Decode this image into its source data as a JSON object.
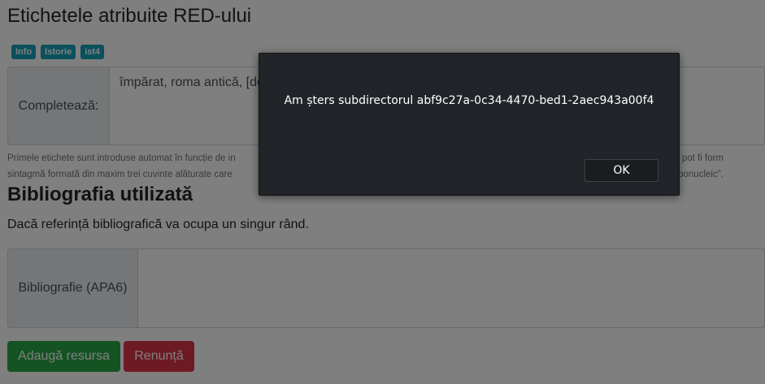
{
  "etichete": {
    "title": "Etichetele atribuite RED-ului",
    "tags": [
      "Info",
      "Istorie",
      "ist4"
    ],
    "field_label": "Completează:",
    "field_value": "împărat, roma antică, [de",
    "help_line1_left": "Primele etichete sunt introduse automat în funcție de in",
    "help_line1_right": "etichetele pot fi form",
    "help_line2_left": "sintagmă formată din maxim trei cuvinte alăturate care",
    "help_line2_right": "bonucleic\"."
  },
  "bibliografie": {
    "title": "Bibliografia utilizată",
    "note": "Dacă referință bibliografică va ocupa un singur rând.",
    "field_label": "Bibliografie (APA6)",
    "field_value": ""
  },
  "actions": {
    "add_label": "Adaugă resursa",
    "cancel_label": "Renunță",
    "add_color": "#28a745",
    "cancel_color": "#dc3545"
  },
  "dialog": {
    "message": "Am șters subdirectorul abf9c27a-0c34-4470-bed1-2aec943a00f4",
    "ok_label": "OK"
  }
}
